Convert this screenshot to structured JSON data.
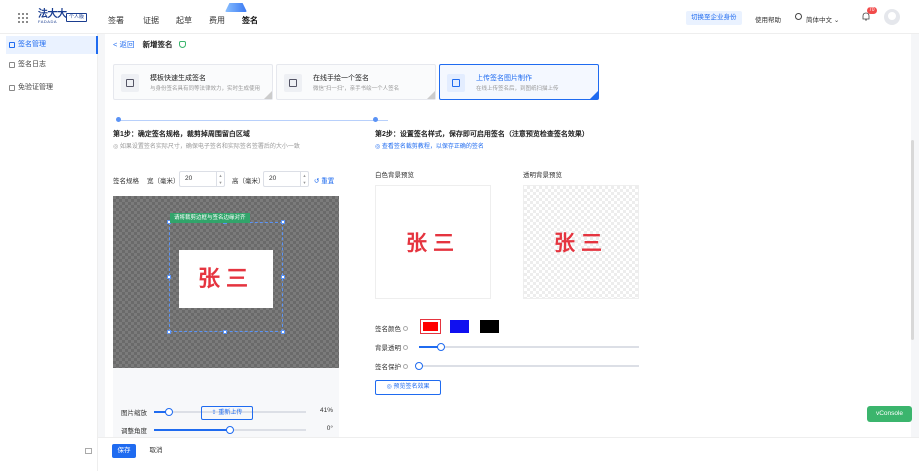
{
  "topbar": {
    "logo_cn": "法大大",
    "logo_en": "FADADA",
    "logo_badge": "个人版",
    "nav": [
      "签署",
      "证据",
      "起草",
      "费用",
      "签名"
    ],
    "active_nav": "签名",
    "switch_enterprise": "切换至企业身份",
    "help": "使用帮助",
    "language": "简体中文",
    "notif_count": "70"
  },
  "sidebar": {
    "items": [
      {
        "label": "签名管理"
      },
      {
        "label": "签名日志"
      },
      {
        "label": "免验证管理"
      }
    ]
  },
  "header": {
    "back": "< 返回",
    "title": "新增签名"
  },
  "modes": [
    {
      "title": "模板快速生成签名",
      "desc": "与身份签名具有同等法律效力，实时生成使用"
    },
    {
      "title": "在线手绘一个签名",
      "desc": "微信“扫一扫”，亲手书绘一个人签名"
    },
    {
      "title": "上传签名图片制作",
      "desc": "在线上传签名后，到图纸扫描上传"
    }
  ],
  "step1": {
    "title": "第1步：确定签名规格，裁剪掉周围留白区域",
    "note": "◎ 如果设置签名实际尺寸，确保电子签名和实际签名签署后的大小一致"
  },
  "step2": {
    "title": "第2步：设置签名样式，保存即可启用签名（注意预览检查签名效果）",
    "link": "◎ 查看签名裁剪教程，以保存正确的签名"
  },
  "spec": {
    "label": "签名规格",
    "width_label": "宽（毫米）",
    "width_value": "20",
    "height_label": "高（毫米）",
    "height_value": "20",
    "reset": "↺ 重置"
  },
  "crop": {
    "tip": "请将裁剪边框与签名边缘对齐",
    "signature_text": "张三"
  },
  "controls": {
    "zoom_label": "图片缩放",
    "zoom_value": "41%",
    "zoom_fraction": 0.1,
    "angle_label": "调整角度",
    "angle_value": "0°",
    "angle_fraction": 0.5,
    "reupload": "⇪ 重新上传"
  },
  "preview": {
    "white_label": "白色背景预览",
    "trans_label": "透明背景预览",
    "signature_text": "张三"
  },
  "style": {
    "color_label": "签名颜色",
    "colors": [
      "#ff0000",
      "#1010f0",
      "#000000"
    ],
    "opacity_label": "背景透明",
    "opacity_fraction": 0.1,
    "blur_label": "签名保护",
    "blur_fraction": 0.0,
    "preview_button": "◎ 预览签名效果"
  },
  "footer": {
    "save": "保存",
    "cancel": "取消"
  },
  "vconsole": "vConsole"
}
